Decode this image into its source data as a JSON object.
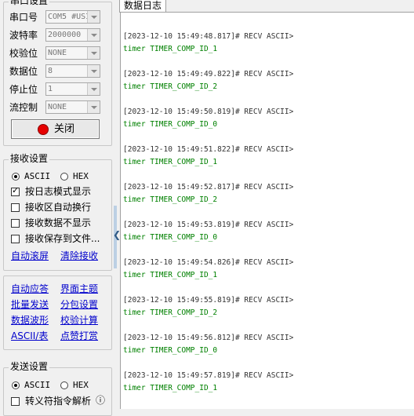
{
  "serial": {
    "title": "串口设置",
    "fields": [
      {
        "label": "串口号",
        "value": "COM5 #USI"
      },
      {
        "label": "波特率",
        "value": "2000000"
      },
      {
        "label": "校验位",
        "value": "NONE"
      },
      {
        "label": "数据位",
        "value": "8"
      },
      {
        "label": "停止位",
        "value": "1"
      },
      {
        "label": "流控制",
        "value": "NONE"
      }
    ],
    "close_label": "关闭"
  },
  "receive": {
    "title": "接收设置",
    "radio_ascii": "ASCII",
    "radio_hex": "HEX",
    "options": [
      {
        "label": "按日志模式显示",
        "checked": true
      },
      {
        "label": "接收区自动换行",
        "checked": false
      },
      {
        "label": "接收数据不显示",
        "checked": false
      },
      {
        "label": "接收保存到文件...",
        "checked": false
      }
    ],
    "link_autoscroll": "自动滚屏",
    "link_clear": "清除接收"
  },
  "tools": {
    "items": [
      "自动应答",
      "界面主题",
      "批量发送",
      "分包设置",
      "数据波形",
      "校验计算",
      "ASCII/表",
      "点赞打赏"
    ]
  },
  "send": {
    "title": "发送设置",
    "radio_ascii": "ASCII",
    "radio_hex": "HEX",
    "escape_label": "转义符指令解析",
    "info_icon": "ⓘ"
  },
  "log": {
    "tab_label": "数据日志",
    "entries": [
      {
        "header": "[2023-12-10 15:49:48.817]# RECV ASCII>",
        "message": "timer TIMER_COMP_ID_1"
      },
      {
        "header": "[2023-12-10 15:49:49.822]# RECV ASCII>",
        "message": "timer TIMER_COMP_ID_2"
      },
      {
        "header": "[2023-12-10 15:49:50.819]# RECV ASCII>",
        "message": "timer TIMER_COMP_ID_0"
      },
      {
        "header": "[2023-12-10 15:49:51.822]# RECV ASCII>",
        "message": "timer TIMER_COMP_ID_1"
      },
      {
        "header": "[2023-12-10 15:49:52.817]# RECV ASCII>",
        "message": "timer TIMER_COMP_ID_2"
      },
      {
        "header": "[2023-12-10 15:49:53.819]# RECV ASCII>",
        "message": "timer TIMER_COMP_ID_0"
      },
      {
        "header": "[2023-12-10 15:49:54.826]# RECV ASCII>",
        "message": "timer TIMER_COMP_ID_1"
      },
      {
        "header": "[2023-12-10 15:49:55.819]# RECV ASCII>",
        "message": "timer TIMER_COMP_ID_2"
      },
      {
        "header": "[2023-12-10 15:49:56.812]# RECV ASCII>",
        "message": "timer TIMER_COMP_ID_0"
      },
      {
        "header": "[2023-12-10 15:49:57.819]# RECV ASCII>",
        "message": "timer TIMER_COMP_ID_1"
      }
    ]
  },
  "colors": {
    "message": "#008000",
    "link": "#0000cc",
    "close_dot": "#e60000"
  }
}
